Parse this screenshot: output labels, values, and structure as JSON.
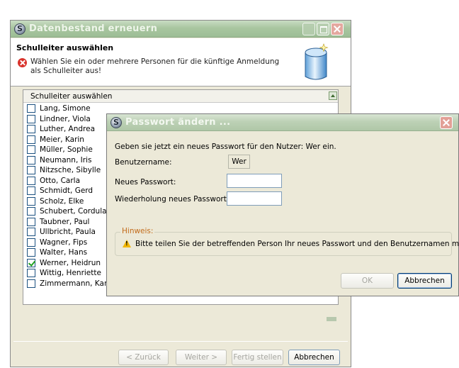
{
  "wizard": {
    "title": "Datenbestand erneuern",
    "header_title": "Schulleiter auswählen",
    "message": "Wählen Sie ein oder mehrere Personen für die künftige Anmeldung als Schulleiter aus!",
    "list_header": "Schulleiter auswählen",
    "persons": [
      {
        "name": "Lang, Simone",
        "checked": false
      },
      {
        "name": "Lindner, Viola",
        "checked": false
      },
      {
        "name": "Luther, Andrea",
        "checked": false
      },
      {
        "name": "Meier, Karin",
        "checked": false
      },
      {
        "name": "Müller, Sophie",
        "checked": false
      },
      {
        "name": "Neumann, Iris",
        "checked": false
      },
      {
        "name": "Nitzsche, Sibylle",
        "checked": false
      },
      {
        "name": "Otto, Carla",
        "checked": false
      },
      {
        "name": "Schmidt, Gerd",
        "checked": false
      },
      {
        "name": "Scholz, Elke",
        "checked": false
      },
      {
        "name": "Schubert, Cordula",
        "checked": false
      },
      {
        "name": "Taubner, Paul",
        "checked": false
      },
      {
        "name": "Ullbricht, Paula",
        "checked": false
      },
      {
        "name": "Wagner, Fips",
        "checked": false
      },
      {
        "name": "Walter, Hans",
        "checked": false
      },
      {
        "name": "Werner, Heidrun",
        "checked": true
      },
      {
        "name": "Wittig, Henriette",
        "checked": false
      },
      {
        "name": "Zimmermann, Karl-H",
        "checked": false
      }
    ],
    "buttons": {
      "back": "< Zurück",
      "next": "Weiter >",
      "finish": "Fertig stellen",
      "cancel": "Abbrechen"
    }
  },
  "dialog": {
    "title": "Passwort ändern ...",
    "intro": "Geben sie jetzt ein neues Passwort für den Nutzer: Wer ein.",
    "username_label": "Benutzername:",
    "username_value": "Wer",
    "new_password_label": "Neues Passwort:",
    "new_password_value": "",
    "repeat_password_label": "Wiederholung neues Passwort:",
    "repeat_password_value": "",
    "hint_title": "Hinweis:",
    "hint_text": "Bitte teilen Sie der betreffenden Person Ihr neues Passwort und den Benutzernamen mit!",
    "ok_label": "OK",
    "cancel_label": "Abbrechen"
  },
  "icons": {
    "app": "app-logo-icon",
    "error": "error-icon",
    "database": "database-icon",
    "warning": "warning-icon",
    "close": "close-icon",
    "collapse": "collapse-icon"
  },
  "colors": {
    "titlebar": "#a9c6a0",
    "window_bg": "#ece9d8",
    "hint_title": "#c26b1a",
    "error": "#d9322b",
    "warning": "#f2b705",
    "check": "#21a121"
  }
}
